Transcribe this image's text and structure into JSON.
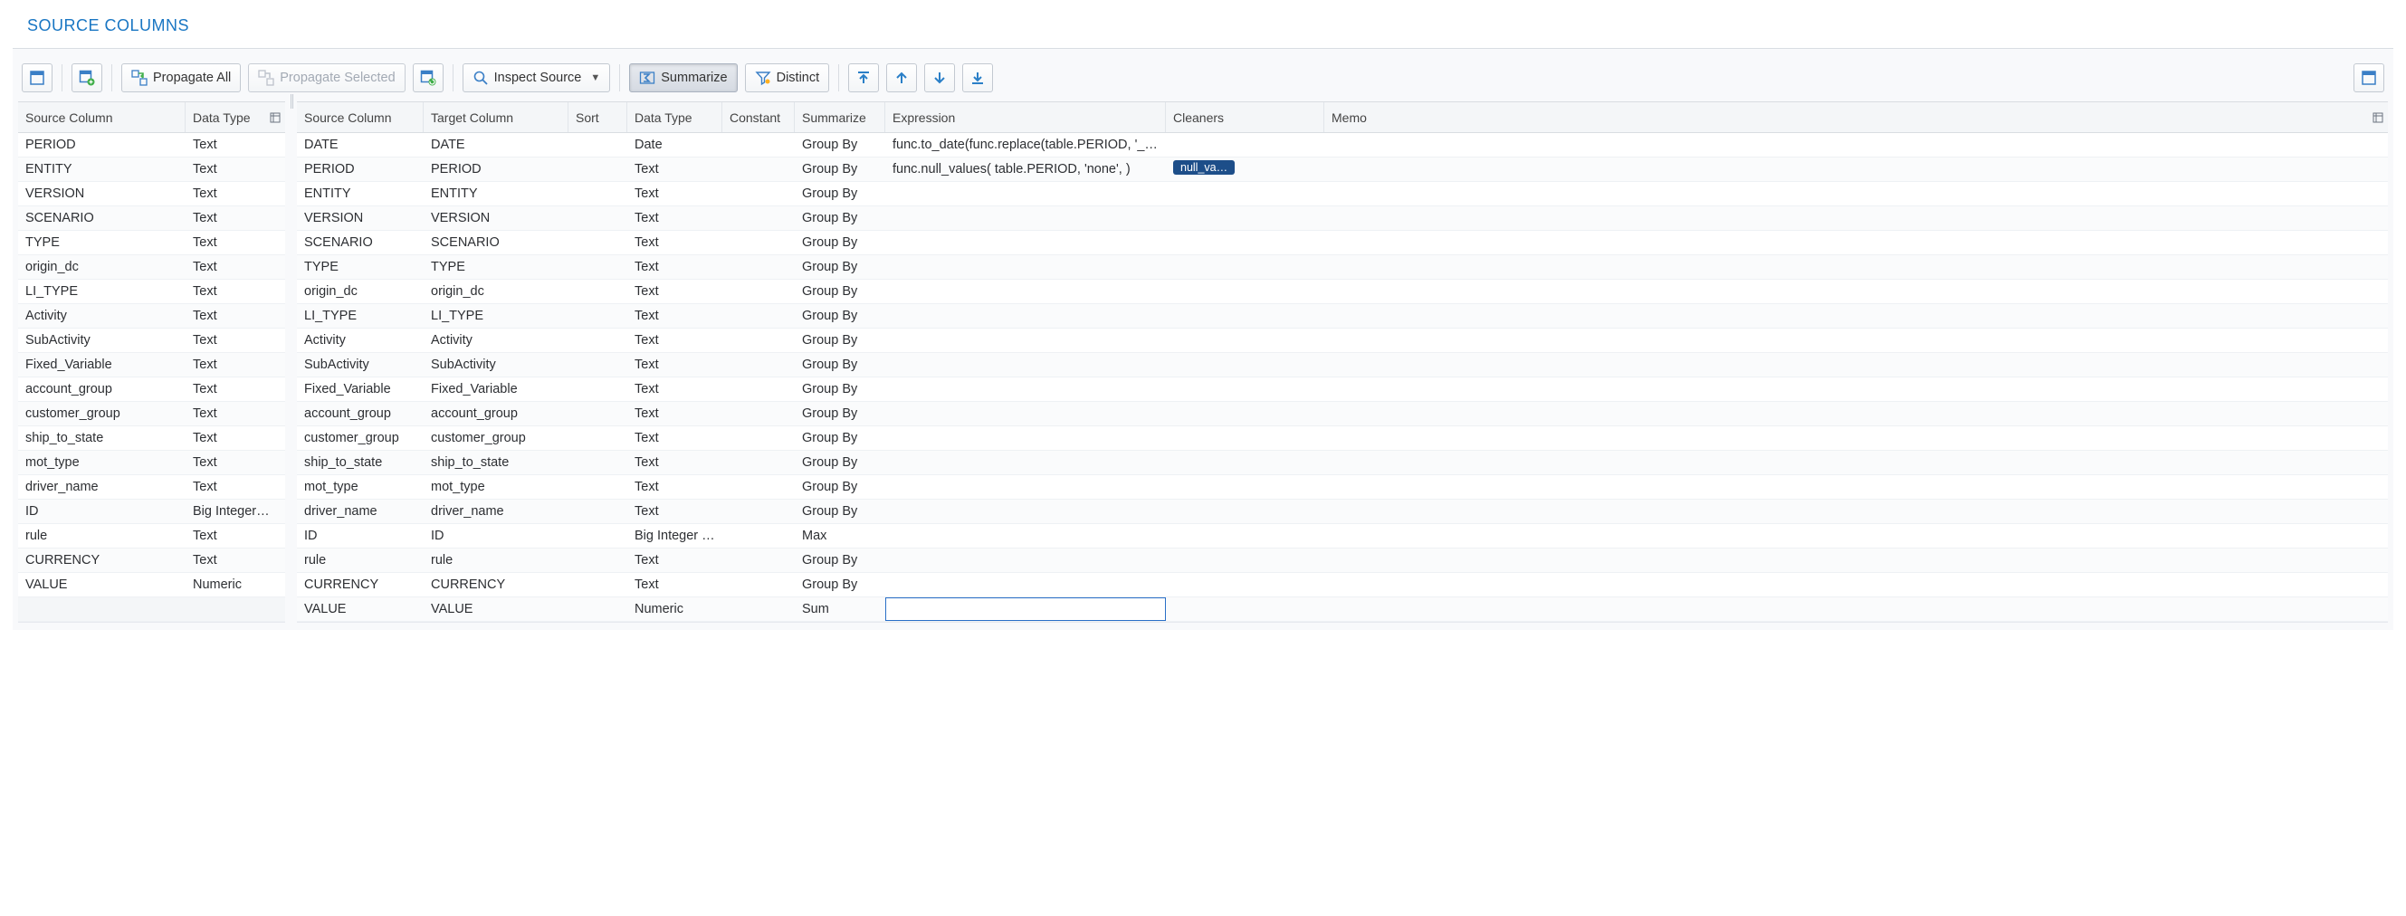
{
  "section_title": "SOURCE COLUMNS",
  "toolbar": {
    "propagate_all": "Propagate All",
    "propagate_selected": "Propagate Selected",
    "inspect_source": "Inspect Source",
    "summarize": "Summarize",
    "distinct": "Distinct"
  },
  "left": {
    "headers": {
      "source_column": "Source Column",
      "data_type": "Data Type"
    },
    "rows": [
      {
        "src": "PERIOD",
        "dt": "Text"
      },
      {
        "src": "ENTITY",
        "dt": "Text"
      },
      {
        "src": "VERSION",
        "dt": "Text"
      },
      {
        "src": "SCENARIO",
        "dt": "Text"
      },
      {
        "src": "TYPE",
        "dt": "Text"
      },
      {
        "src": "origin_dc",
        "dt": "Text"
      },
      {
        "src": "LI_TYPE",
        "dt": "Text"
      },
      {
        "src": "Activity",
        "dt": "Text"
      },
      {
        "src": "SubActivity",
        "dt": "Text"
      },
      {
        "src": "Fixed_Variable",
        "dt": "Text"
      },
      {
        "src": "account_group",
        "dt": "Text"
      },
      {
        "src": "customer_group",
        "dt": "Text"
      },
      {
        "src": "ship_to_state",
        "dt": "Text"
      },
      {
        "src": "mot_type",
        "dt": "Text"
      },
      {
        "src": "driver_name",
        "dt": "Text"
      },
      {
        "src": "ID",
        "dt": "Big Integer…"
      },
      {
        "src": "rule",
        "dt": "Text"
      },
      {
        "src": "CURRENCY",
        "dt": "Text"
      },
      {
        "src": "VALUE",
        "dt": "Numeric"
      }
    ]
  },
  "right": {
    "headers": {
      "source_column": "Source Column",
      "target_column": "Target Column",
      "sort": "Sort",
      "data_type": "Data Type",
      "constant": "Constant",
      "summarize": "Summarize",
      "expression": "Expression",
      "cleaners": "Cleaners",
      "memo": "Memo"
    },
    "rows": [
      {
        "src": "DATE",
        "tgt": "DATE",
        "sort": "",
        "dt": "Date",
        "const": "",
        "summ": "Group By",
        "expr": "func.to_date(func.replace(table.PERIOD, '_', ''), '…",
        "clean": "",
        "memo": ""
      },
      {
        "src": "PERIOD",
        "tgt": "PERIOD",
        "sort": "",
        "dt": "Text",
        "const": "",
        "summ": "Group By",
        "expr": "func.null_values( table.PERIOD, 'none', )",
        "clean": "null_va…",
        "memo": ""
      },
      {
        "src": "ENTITY",
        "tgt": "ENTITY",
        "sort": "",
        "dt": "Text",
        "const": "",
        "summ": "Group By",
        "expr": "",
        "clean": "",
        "memo": ""
      },
      {
        "src": "VERSION",
        "tgt": "VERSION",
        "sort": "",
        "dt": "Text",
        "const": "",
        "summ": "Group By",
        "expr": "",
        "clean": "",
        "memo": ""
      },
      {
        "src": "SCENARIO",
        "tgt": "SCENARIO",
        "sort": "",
        "dt": "Text",
        "const": "",
        "summ": "Group By",
        "expr": "",
        "clean": "",
        "memo": ""
      },
      {
        "src": "TYPE",
        "tgt": "TYPE",
        "sort": "",
        "dt": "Text",
        "const": "",
        "summ": "Group By",
        "expr": "",
        "clean": "",
        "memo": ""
      },
      {
        "src": "origin_dc",
        "tgt": "origin_dc",
        "sort": "",
        "dt": "Text",
        "const": "",
        "summ": "Group By",
        "expr": "",
        "clean": "",
        "memo": ""
      },
      {
        "src": "LI_TYPE",
        "tgt": "LI_TYPE",
        "sort": "",
        "dt": "Text",
        "const": "",
        "summ": "Group By",
        "expr": "",
        "clean": "",
        "memo": ""
      },
      {
        "src": "Activity",
        "tgt": "Activity",
        "sort": "",
        "dt": "Text",
        "const": "",
        "summ": "Group By",
        "expr": "",
        "clean": "",
        "memo": ""
      },
      {
        "src": "SubActivity",
        "tgt": "SubActivity",
        "sort": "",
        "dt": "Text",
        "const": "",
        "summ": "Group By",
        "expr": "",
        "clean": "",
        "memo": ""
      },
      {
        "src": "Fixed_Variable",
        "tgt": "Fixed_Variable",
        "sort": "",
        "dt": "Text",
        "const": "",
        "summ": "Group By",
        "expr": "",
        "clean": "",
        "memo": ""
      },
      {
        "src": "account_group",
        "tgt": "account_group",
        "sort": "",
        "dt": "Text",
        "const": "",
        "summ": "Group By",
        "expr": "",
        "clean": "",
        "memo": ""
      },
      {
        "src": "customer_group",
        "tgt": "customer_group",
        "sort": "",
        "dt": "Text",
        "const": "",
        "summ": "Group By",
        "expr": "",
        "clean": "",
        "memo": ""
      },
      {
        "src": "ship_to_state",
        "tgt": "ship_to_state",
        "sort": "",
        "dt": "Text",
        "const": "",
        "summ": "Group By",
        "expr": "",
        "clean": "",
        "memo": ""
      },
      {
        "src": "mot_type",
        "tgt": "mot_type",
        "sort": "",
        "dt": "Text",
        "const": "",
        "summ": "Group By",
        "expr": "",
        "clean": "",
        "memo": ""
      },
      {
        "src": "driver_name",
        "tgt": "driver_name",
        "sort": "",
        "dt": "Text",
        "const": "",
        "summ": "Group By",
        "expr": "",
        "clean": "",
        "memo": ""
      },
      {
        "src": "ID",
        "tgt": "ID",
        "sort": "",
        "dt": "Big Integer (…",
        "const": "",
        "summ": "Max",
        "expr": "",
        "clean": "",
        "memo": ""
      },
      {
        "src": "rule",
        "tgt": "rule",
        "sort": "",
        "dt": "Text",
        "const": "",
        "summ": "Group By",
        "expr": "",
        "clean": "",
        "memo": ""
      },
      {
        "src": "CURRENCY",
        "tgt": "CURRENCY",
        "sort": "",
        "dt": "Text",
        "const": "",
        "summ": "Group By",
        "expr": "",
        "clean": "",
        "memo": ""
      },
      {
        "src": "VALUE",
        "tgt": "VALUE",
        "sort": "",
        "dt": "Numeric",
        "const": "",
        "summ": "Sum",
        "expr": "",
        "clean": "",
        "memo": "",
        "focused": "expr"
      }
    ]
  }
}
